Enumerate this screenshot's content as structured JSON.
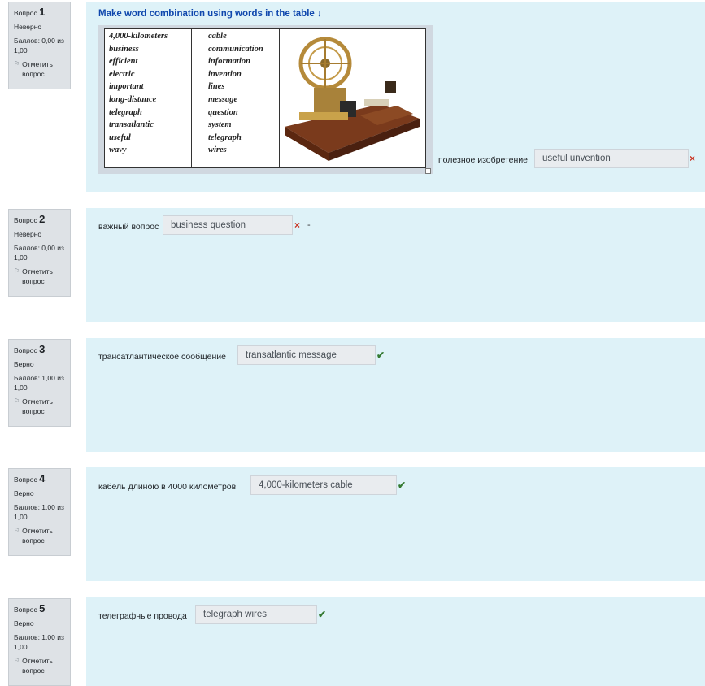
{
  "questions": [
    {
      "number_label": "Вопрос",
      "number": "1",
      "status": "Неверно",
      "score": "Баллов: 0,00 из 1,00",
      "flag_label": "Отметить вопрос",
      "title": "Make word combination using words in the table ↓",
      "table": {
        "col1": [
          "4,000-kilometers",
          "business",
          "efficient",
          "electric",
          "important",
          "long-distance",
          "telegraph",
          "transatlantic",
          "useful",
          "wavy"
        ],
        "col2": [
          "cable",
          "communication",
          "information",
          "invention",
          "lines",
          "message",
          "question",
          "system",
          "telegraph",
          "wires"
        ]
      },
      "prompt": "полезное изобретение",
      "answer": "useful unvention",
      "result": "wrong"
    },
    {
      "number_label": "Вопрос",
      "number": "2",
      "status": "Неверно",
      "score": "Баллов: 0,00 из 1,00",
      "flag_label": "Отметить вопрос",
      "prompt": "важный вопрос",
      "answer": "business question",
      "trailing": "-",
      "result": "wrong"
    },
    {
      "number_label": "Вопрос",
      "number": "3",
      "status": "Верно",
      "score": "Баллов: 1,00 из 1,00",
      "flag_label": "Отметить вопрос",
      "prompt": "трансатлантическое сообщение",
      "answer": "transatlantic message",
      "result": "right"
    },
    {
      "number_label": "Вопрос",
      "number": "4",
      "status": "Верно",
      "score": "Баллов: 1,00 из 1,00",
      "flag_label": "Отметить вопрос",
      "prompt": "кабель длиною в 4000 километров",
      "answer": "4,000-kilometers cable",
      "result": "right"
    },
    {
      "number_label": "Вопрос",
      "number": "5",
      "status": "Верно",
      "score": "Баллов: 1,00 из 1,00",
      "flag_label": "Отметить вопрос",
      "prompt": "телеграфные провода",
      "answer": "telegraph wires",
      "result": "right"
    }
  ],
  "icons": {
    "wrong": "×",
    "right": "✔",
    "flag": "⚐"
  },
  "colors": {
    "content_bg": "#def2f8",
    "info_bg": "#dee2e6",
    "wrong": "#ca3120",
    "right": "#357a32",
    "title": "#0f47ad"
  }
}
